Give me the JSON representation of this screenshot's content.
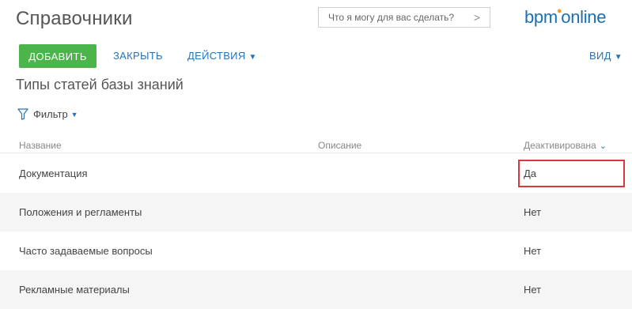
{
  "header": {
    "title": "Справочники",
    "command_placeholder": "Что я могу для вас сделать?",
    "logo_text_left": "bpm",
    "logo_text_right": "online"
  },
  "toolbar": {
    "add_label": "ДОБАВИТЬ",
    "close_label": "ЗАКРЫТЬ",
    "actions_label": "ДЕЙСТВИЯ",
    "view_label": "ВИД"
  },
  "section": {
    "title": "Типы статей базы знаний",
    "filter_label": "Фильтр"
  },
  "table": {
    "columns": [
      "Название",
      "Описание",
      "Деактивирована"
    ],
    "rows": [
      {
        "name": "Документация",
        "description": "",
        "deactivated": "Да"
      },
      {
        "name": "Положения и регламенты",
        "description": "",
        "deactivated": "Нет"
      },
      {
        "name": "Часто задаваемые вопросы",
        "description": "",
        "deactivated": "Нет"
      },
      {
        "name": "Рекламные материалы",
        "description": "",
        "deactivated": "Нет"
      }
    ]
  },
  "colors": {
    "accent": "#2574ba",
    "add_button": "#4bb44b",
    "highlight_border": "#d9393d",
    "logo_dot": "#f49a24"
  }
}
